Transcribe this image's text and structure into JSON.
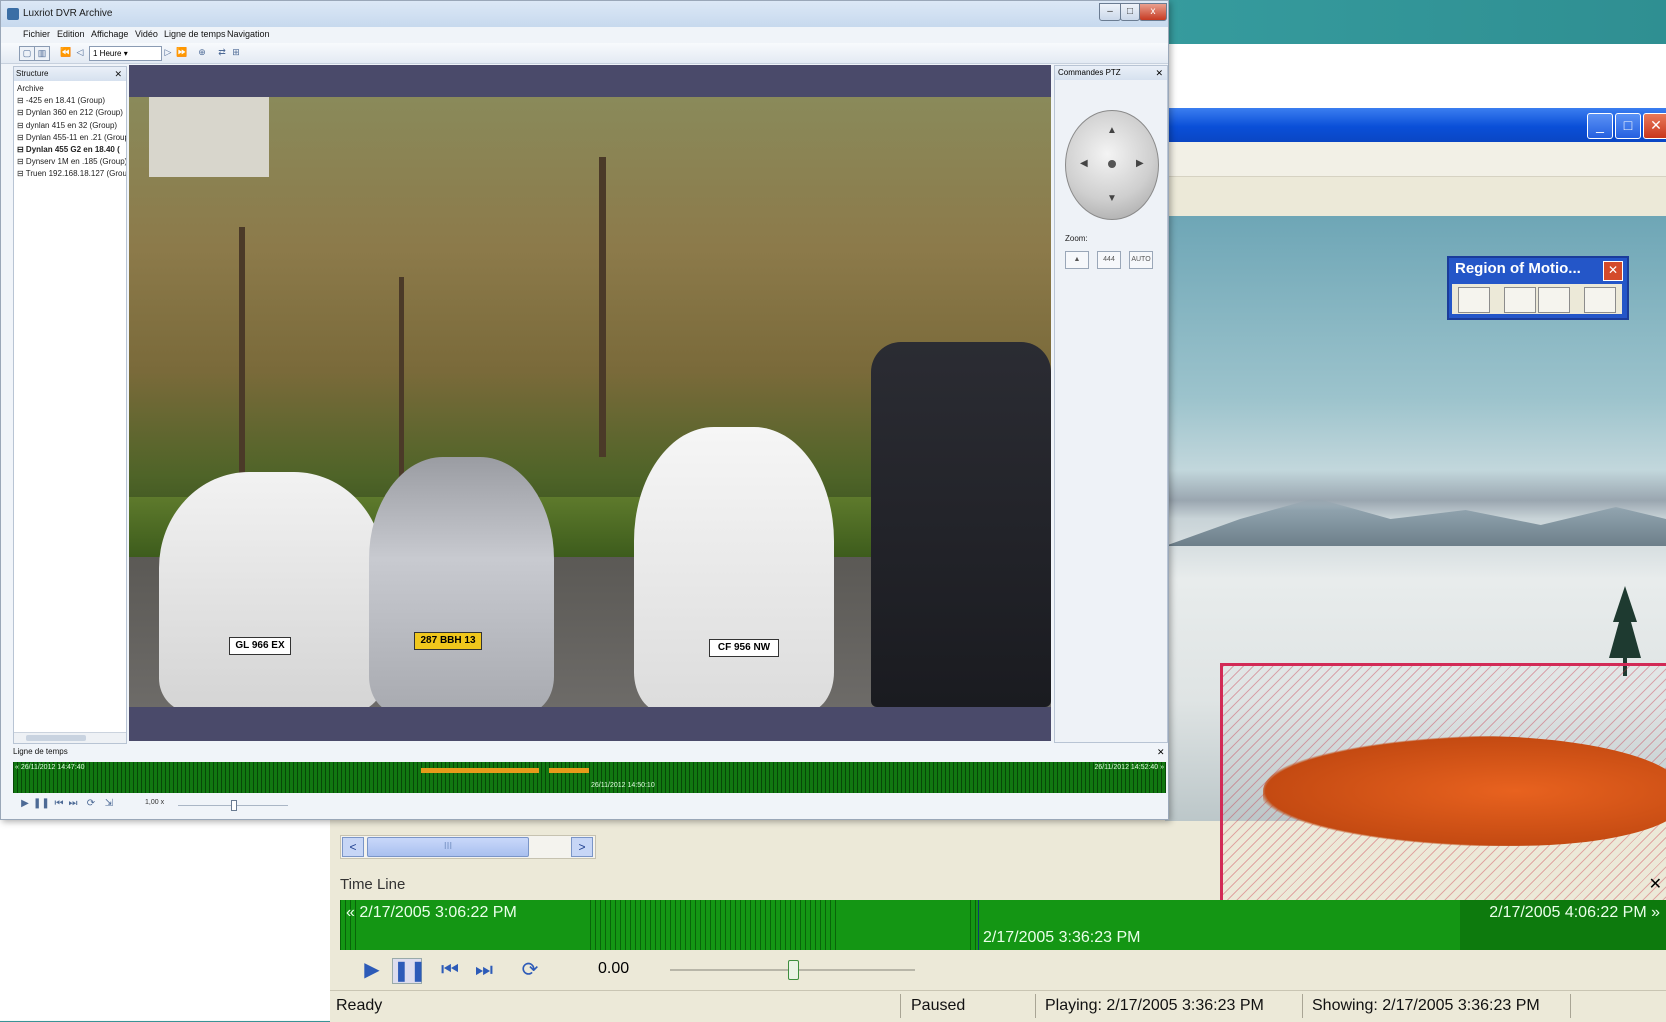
{
  "back_window": {
    "title_buttons": [
      "_",
      "□",
      "✕"
    ],
    "region_panel": {
      "title": "Region of Motio...",
      "close": "✕"
    },
    "scroll": {
      "left_arrow": "<",
      "right_arrow": ">",
      "thumb_grip": "III"
    },
    "timeline": {
      "label": "Time Line",
      "close": "✕",
      "start": "« 2/17/2005 3:06:22 PM",
      "end": "2/17/2005 4:06:22 PM »",
      "cursor_time": "2/17/2005 3:36:23 PM"
    },
    "controls": {
      "speed": "0.00",
      "slider_position_fraction": 0.5
    },
    "status": {
      "ready": "Ready",
      "paused": "Paused",
      "playing": "Playing: 2/17/2005 3:36:23 PM",
      "showing": "Showing: 2/17/2005 3:36:23 PM"
    }
  },
  "front_window": {
    "title": "Luxriot DVR Archive",
    "menu": [
      "Fichier",
      "Edition",
      "Affichage",
      "Vidéo",
      "Ligne de temps",
      "Navigation"
    ],
    "toolbar": {
      "interval_select": "1 Heure"
    },
    "structure_panel": {
      "title": "Structure",
      "close": "✕",
      "root": "Archive",
      "items": [
        "⊟ -425 en 18.41 (Group)",
        "⊟ Dynlan 360 en 212 (Group)",
        "⊟ dynlan 415 en 32 (Group)",
        "⊟ Dynlan 455-11 en .21 (Group)",
        "⊟ Dynlan 455 G2 en 18.40 (",
        "⊟ Dynserv 1M en .185 (Group)",
        "⊟ Truen 192.168.18.127 (Group)"
      ],
      "selected_index": 4
    },
    "ptz_panel": {
      "title": "Commandes PTZ",
      "close": "✕",
      "zoom_label": "Zoom:",
      "zoom_buttons": [
        "▲",
        "444",
        "AUTO"
      ]
    },
    "video": {
      "plates": [
        "GL 966 EX",
        "287 BBH 13",
        "CF 956 NW"
      ]
    },
    "timeline": {
      "label": "Ligne de temps",
      "close": "✕",
      "start": "« 26/11/2012 14:47:40",
      "end": "26/11/2012 14:52:40 »",
      "cursor_time": "26/11/2012 14:50:10"
    },
    "controls": {
      "speed": "1,00 x"
    }
  },
  "colors": {
    "timeline_green": "#149614",
    "motion_region": "#d22a56",
    "xp_title_blue": "#0a4fd8",
    "teal_background": "#2f8c8f"
  }
}
